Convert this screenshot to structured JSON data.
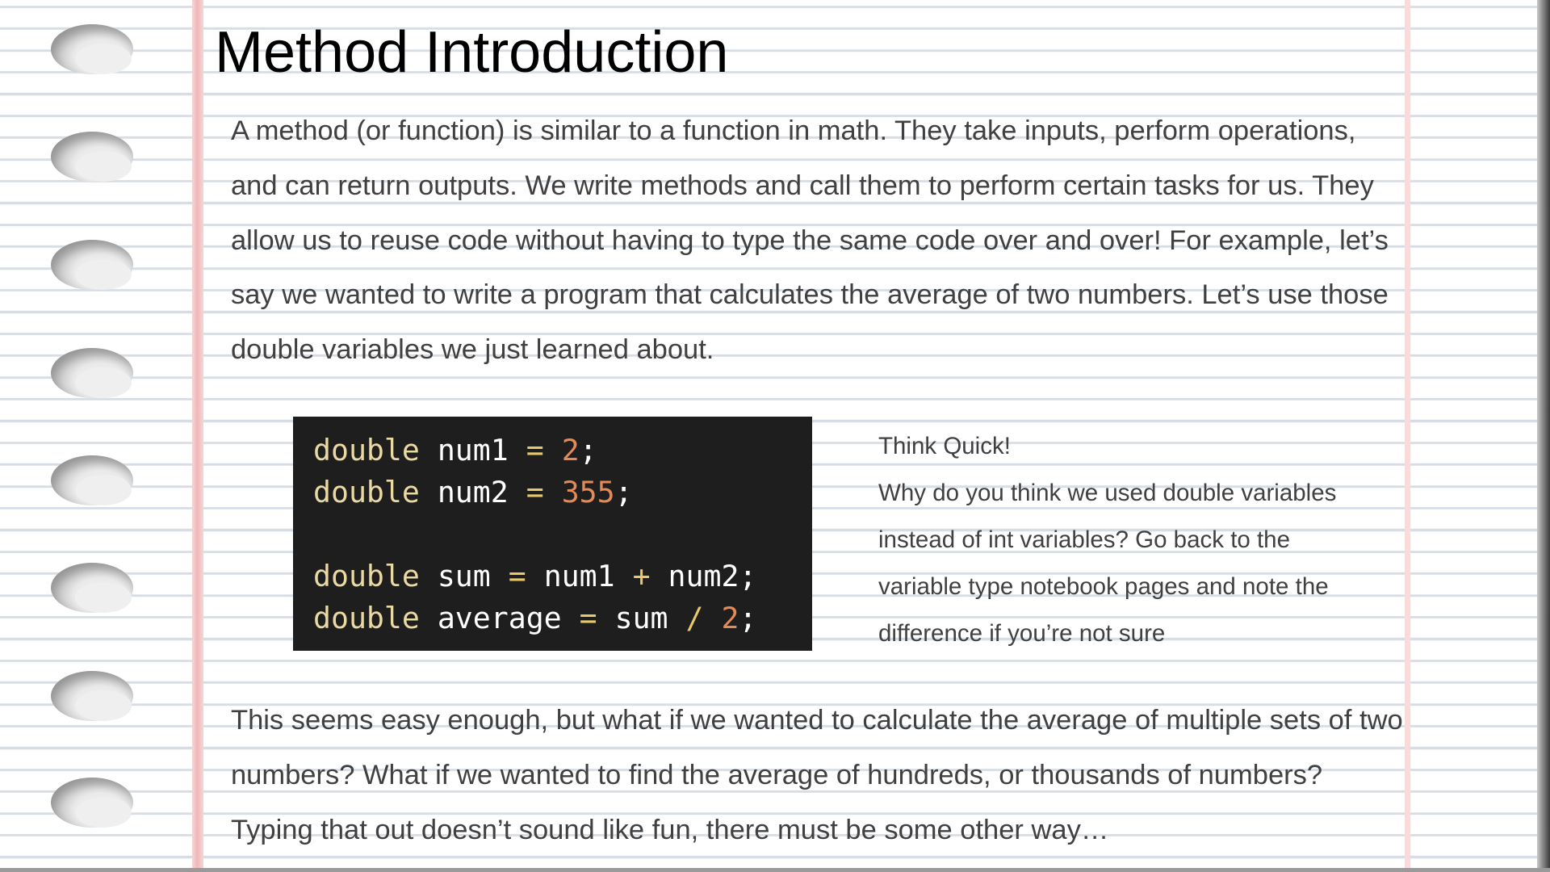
{
  "page": {
    "title": "Method Introduction",
    "intro_paragraph": "A method (or function) is similar to a function in math. They take inputs, perform operations, and can return outputs. We write methods and call them to perform certain tasks for us. They allow us to reuse code without having to type the same code over and over! For example, let’s say we wanted to write a program that calculates the average of two numbers. Let’s use those double variables we just learned about.",
    "closing_paragraph": "This seems easy enough, but what if we wanted to calculate the average of multiple sets of two numbers? What if we wanted to find the average of hundreds, or thousands of numbers? Typing that out doesn’t sound like fun, there must be some other way…"
  },
  "code_example": {
    "language": "java",
    "lines": [
      [
        {
          "t": "double",
          "k": "type"
        },
        {
          "t": " num1 ",
          "k": "id"
        },
        {
          "t": "=",
          "k": "op"
        },
        {
          "t": " ",
          "k": "id"
        },
        {
          "t": "2",
          "k": "num"
        },
        {
          "t": ";",
          "k": "id"
        }
      ],
      [
        {
          "t": "double",
          "k": "type"
        },
        {
          "t": " num2 ",
          "k": "id"
        },
        {
          "t": "=",
          "k": "op"
        },
        {
          "t": " ",
          "k": "id"
        },
        {
          "t": "355",
          "k": "num"
        },
        {
          "t": ";",
          "k": "id"
        }
      ],
      [],
      [
        {
          "t": "double",
          "k": "type"
        },
        {
          "t": " sum ",
          "k": "id"
        },
        {
          "t": "=",
          "k": "op"
        },
        {
          "t": " num1 ",
          "k": "id"
        },
        {
          "t": "+",
          "k": "op"
        },
        {
          "t": " num2;",
          "k": "id"
        }
      ],
      [
        {
          "t": "double",
          "k": "type"
        },
        {
          "t": " average ",
          "k": "id"
        },
        {
          "t": "=",
          "k": "op"
        },
        {
          "t": " sum ",
          "k": "id"
        },
        {
          "t": "/",
          "k": "op"
        },
        {
          "t": " ",
          "k": "id"
        },
        {
          "t": "2",
          "k": "num"
        },
        {
          "t": ";",
          "k": "id"
        }
      ]
    ]
  },
  "think_quick": {
    "heading": "Think Quick!",
    "lines": [
      "Why do you think we used double variables",
      "instead of int variables? Go back to the",
      "variable type notebook pages and note the",
      "difference if you’re not sure"
    ]
  },
  "colors": {
    "code_background": "#1e1e1e",
    "keyword": "#ebd9a3",
    "operator": "#e8c86a",
    "number": "#e58a57",
    "body_text": "#404040",
    "ruled_line": "#d6dde4",
    "margin_line": "#f0b7b7"
  },
  "icons": {
    "binder_hole": "binder-hole-icon"
  }
}
